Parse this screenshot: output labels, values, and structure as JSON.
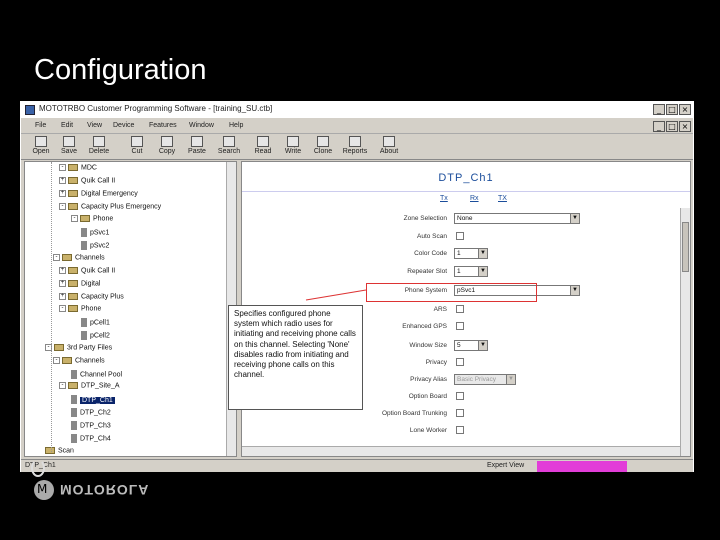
{
  "slide": {
    "title": "Configuration"
  },
  "window": {
    "title": "MOTOTRBO Customer Programming Software - [training_SU.ctb]",
    "controls": {
      "minimize": "_",
      "maximize": "□",
      "close": "×"
    },
    "menu": [
      "File",
      "Edit",
      "View",
      "Device",
      "Features",
      "Window",
      "Help"
    ],
    "toolbar": [
      "Open",
      "Save",
      "Delete",
      "Cut",
      "Copy",
      "Paste",
      "Search",
      "Read",
      "Write",
      "Clone",
      "Reports",
      "About"
    ]
  },
  "tree": {
    "items": [
      {
        "label": "MDC",
        "expander": "-",
        "icon": "folder"
      },
      {
        "label": "Quik Call II",
        "expander": "+",
        "icon": "folder"
      },
      {
        "label": "Digital Emergency",
        "expander": "+",
        "icon": "folder"
      },
      {
        "label": "Capacity Plus Emergency",
        "expander": "-",
        "icon": "folder"
      },
      {
        "label": "Phone",
        "expander": "-",
        "icon": "folder"
      },
      {
        "label": "pSvc1",
        "expander": "",
        "icon": "device"
      },
      {
        "label": "pSvc2",
        "expander": "",
        "icon": "device"
      },
      {
        "label": "Channels",
        "expander": "-",
        "icon": "folder"
      },
      {
        "label": "Quik Call II",
        "expander": "+",
        "icon": "folder"
      },
      {
        "label": "Digital",
        "expander": "+",
        "icon": "folder"
      },
      {
        "label": "Capacity Plus",
        "expander": "+",
        "icon": "folder"
      },
      {
        "label": "Phone",
        "expander": "-",
        "icon": "folder"
      },
      {
        "label": "pCell1",
        "expander": "",
        "icon": "device"
      },
      {
        "label": "pCell2",
        "expander": "",
        "icon": "device"
      },
      {
        "label": "3rd Party Files",
        "expander": "-",
        "icon": "folder"
      },
      {
        "label": "Channels",
        "expander": "-",
        "icon": "folder"
      },
      {
        "label": "Channel Pool",
        "expander": "",
        "icon": "device"
      },
      {
        "label": "DTP_Site_A",
        "expander": "-",
        "icon": "folder"
      },
      {
        "label": "DTP_Ch1",
        "expander": "",
        "icon": "device",
        "selected": true
      },
      {
        "label": "DTP_Ch2",
        "expander": "",
        "icon": "device"
      },
      {
        "label": "DTP_Ch3",
        "expander": "",
        "icon": "device"
      },
      {
        "label": "DTP_Ch4",
        "expander": "",
        "icon": "device"
      },
      {
        "label": "Scan",
        "expander": "",
        "icon": "folder"
      }
    ]
  },
  "panel": {
    "title": "DTP_Ch1",
    "tabs": [
      "Tx",
      "Rx",
      "TX"
    ],
    "fields": [
      {
        "label": "Zone Selection",
        "type": "select",
        "value": "None"
      },
      {
        "label": "Auto Scan",
        "type": "check"
      },
      {
        "label": "Color Code",
        "type": "select-small",
        "value": "1"
      },
      {
        "label": "Repeater Slot",
        "type": "select-small",
        "value": "1"
      },
      {
        "label": "Phone System",
        "type": "select",
        "value": "pSvc1"
      },
      {
        "label": "ARS",
        "type": "check"
      },
      {
        "label": "Enhanced GPS",
        "type": "check"
      },
      {
        "label": "Window Size",
        "type": "select-small",
        "value": "5"
      },
      {
        "label": "Privacy",
        "type": "check"
      },
      {
        "label": "Privacy Alias",
        "type": "select-disabled",
        "value": "Basic Privacy"
      },
      {
        "label": "Option Board",
        "type": "check"
      },
      {
        "label": "Option Board Trunking",
        "type": "check"
      },
      {
        "label": "Lone Worker",
        "type": "check"
      }
    ]
  },
  "tooltip": {
    "text": "Specifies configured phone system which radio uses for initiating and receiving phone calls on this channel. Selecting 'None' disables radio from initiating and receiving phone calls on this channel."
  },
  "status": {
    "left": "DTP_Ch1",
    "mode": "Expert View"
  },
  "logo": {
    "text": "MOTOROLA"
  }
}
